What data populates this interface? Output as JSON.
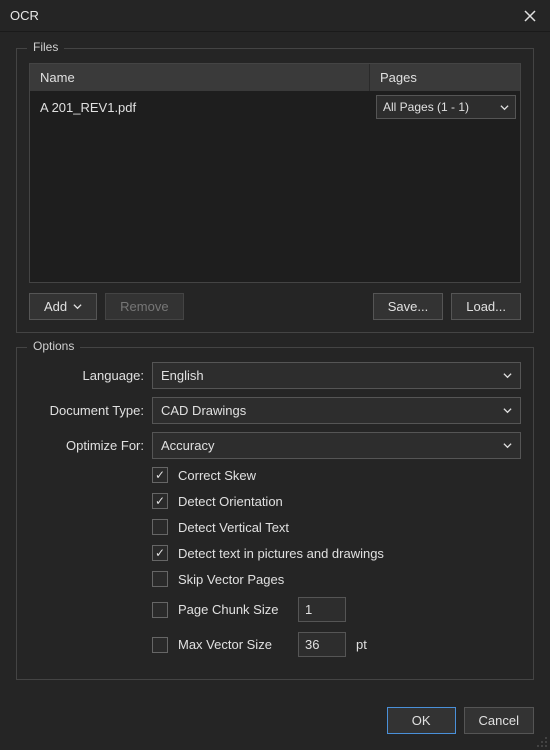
{
  "title": "OCR",
  "groups": {
    "files": "Files",
    "options": "Options"
  },
  "files": {
    "columns": {
      "name": "Name",
      "pages": "Pages"
    },
    "rows": [
      {
        "name": "A 201_REV1.pdf",
        "pages": "All Pages (1 - 1)"
      }
    ],
    "actions": {
      "add": "Add",
      "remove": "Remove",
      "save": "Save...",
      "load": "Load..."
    }
  },
  "options": {
    "language": {
      "label": "Language:",
      "value": "English"
    },
    "doctype": {
      "label": "Document Type:",
      "value": "CAD Drawings"
    },
    "optimize": {
      "label": "Optimize For:",
      "value": "Accuracy"
    },
    "checks": {
      "correct_skew": {
        "label": "Correct Skew",
        "checked": true
      },
      "detect_orientation": {
        "label": "Detect Orientation",
        "checked": true
      },
      "detect_vertical": {
        "label": "Detect Vertical Text",
        "checked": false
      },
      "detect_pictures": {
        "label": "Detect text in pictures and drawings",
        "checked": true
      },
      "skip_vector": {
        "label": "Skip Vector Pages",
        "checked": false
      },
      "page_chunk": {
        "label": "Page Chunk Size",
        "checked": false,
        "value": "1"
      },
      "max_vector": {
        "label": "Max Vector Size",
        "checked": false,
        "value": "36",
        "unit": "pt"
      }
    }
  },
  "footer": {
    "ok": "OK",
    "cancel": "Cancel"
  }
}
